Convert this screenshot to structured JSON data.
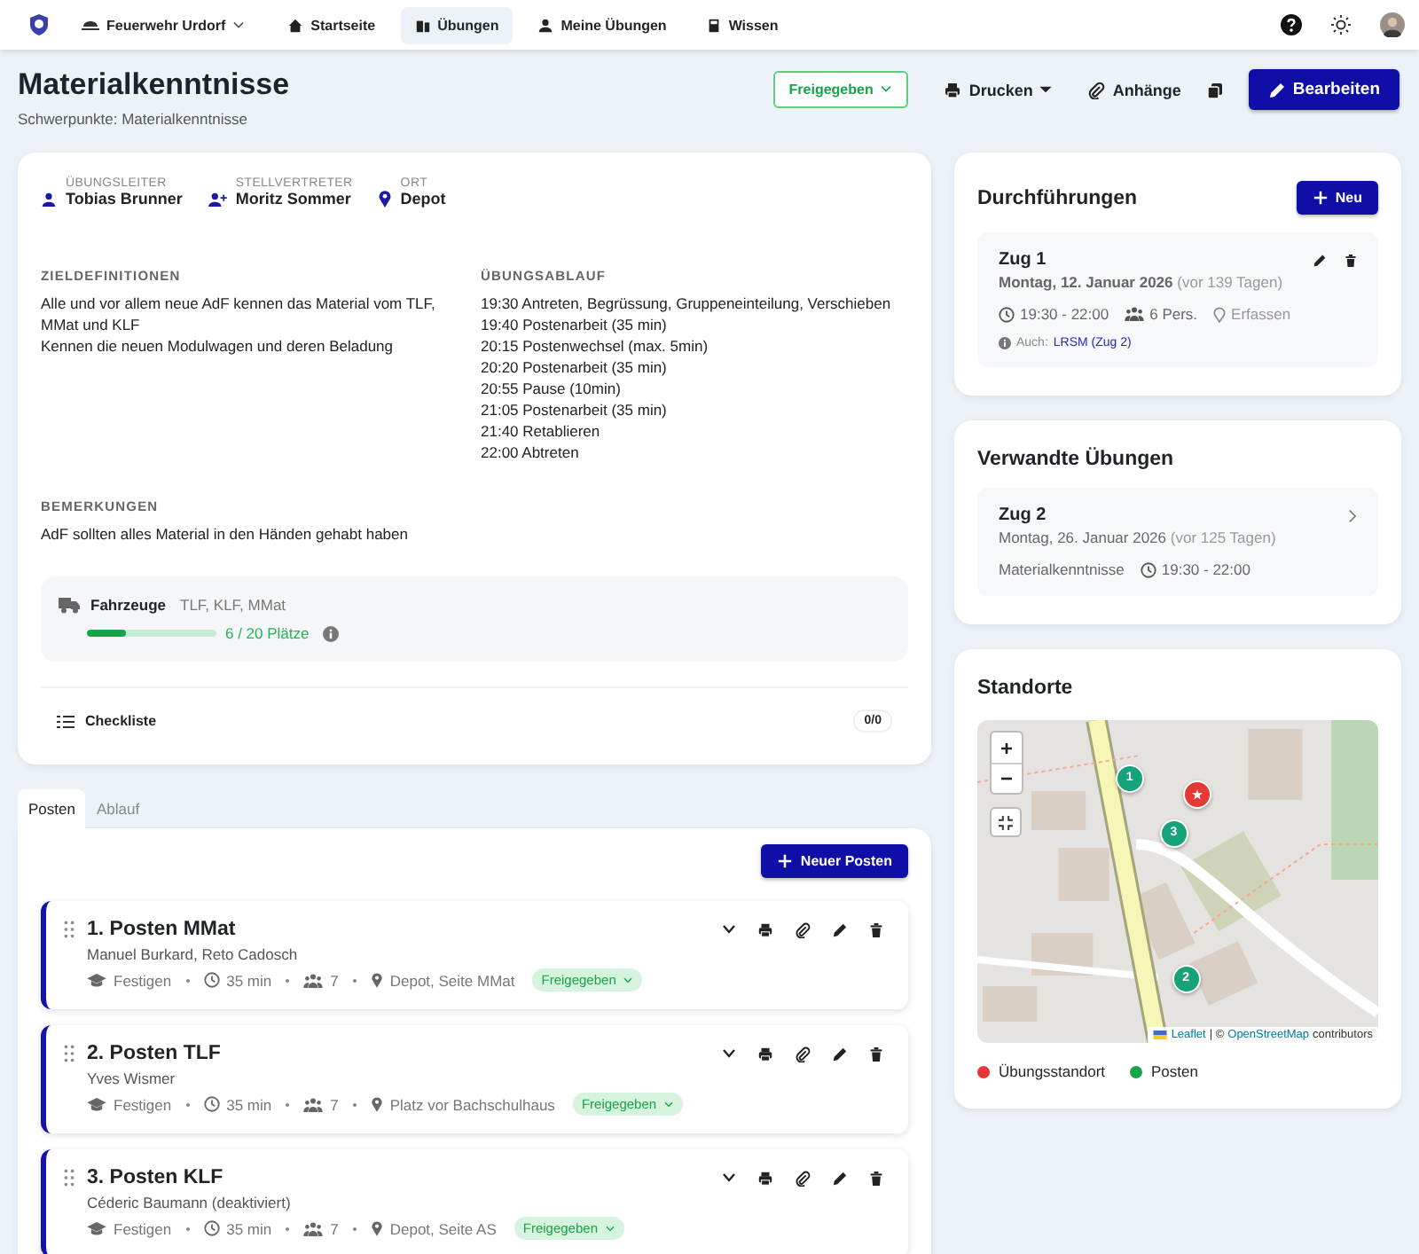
{
  "nav": {
    "org": "Feuerwehr Urdorf",
    "items": [
      {
        "label": "Startseite",
        "selected": false
      },
      {
        "label": "Übungen",
        "selected": true
      },
      {
        "label": "Meine Übungen",
        "selected": false
      },
      {
        "label": "Wissen",
        "selected": false
      }
    ]
  },
  "header": {
    "title": "Materialkenntnisse",
    "subtitle": "Schwerpunkte: Materialkenntnisse",
    "status": "Freigegeben",
    "print": "Drucken",
    "attachments": "Anhänge",
    "edit": "Bearbeiten"
  },
  "info": {
    "people": [
      {
        "label": "ÜBUNGSLEITER",
        "value": "Tobias Brunner",
        "kind": "person"
      },
      {
        "label": "STELLVERTRETER",
        "value": "Moritz Sommer",
        "kind": "deputy"
      },
      {
        "label": "ORT",
        "value": "Depot",
        "kind": "place"
      }
    ],
    "goals": {
      "heading": "ZIELDEFINITIONEN",
      "lines": [
        "Alle und vor allem neue AdF kennen das Material vom TLF, MMat und KLF",
        "Kennen die neuen Modulwagen und deren Beladung"
      ]
    },
    "schedule": {
      "heading": "ÜBUNGSABLAUF",
      "lines": [
        "19:30 Antreten, Begrüssung, Gruppeneinteilung, Verschieben",
        "19:40 Postenarbeit (35 min)",
        "20:15 Postenwechsel (max. 5min)",
        "20:20 Postenarbeit (35 min)",
        "20:55 Pause (10min)",
        "21:05 Postenarbeit (35 min)",
        "21:40 Retablieren",
        "22:00 Abtreten"
      ]
    },
    "remarks": {
      "heading": "BEMERKUNGEN",
      "text": "AdF sollten alles Material in den Händen gehabt haben"
    },
    "vehicles": {
      "label": "Fahrzeuge",
      "list": "TLF, KLF, MMat",
      "level": 0.3,
      "reading": "6 / 20 Plätze"
    },
    "checklist": {
      "label": "Checkliste",
      "count": "0/0"
    }
  },
  "tabs": [
    {
      "label": "Posten",
      "selected": true
    },
    {
      "label": "Ablauf",
      "selected": false
    }
  ],
  "new_post": "Neuer Posten",
  "posts": [
    {
      "title": "1. Posten MMat",
      "people": "Manuel Burkard, Reto Cadosch",
      "category": "Festigen",
      "duration": "35 min",
      "count": "7",
      "location": "Depot, Seite MMat",
      "status": "Freigegeben"
    },
    {
      "title": "2. Posten TLF",
      "people": "Yves Wismer",
      "category": "Festigen",
      "duration": "35 min",
      "count": "7",
      "location": "Platz vor Bachschulhaus",
      "status": "Freigegeben"
    },
    {
      "title": "3. Posten KLF",
      "people": "Céderic Baumann (deaktiviert)",
      "category": "Festigen",
      "duration": "35 min",
      "count": "7",
      "location": "Depot, Seite AS",
      "status": "Freigegeben"
    }
  ],
  "executions": {
    "title": "Durchführungen",
    "new": "Neu",
    "items": [
      {
        "name": "Zug 1",
        "date": "Montag, 12. Januar 2026",
        "relative": "(vor 139 Tagen)",
        "time": "19:30 - 22:00",
        "persons": "6 Pers.",
        "location": "Erfassen",
        "note": "Auch:",
        "link": "LRSM (Zug 2)"
      }
    ]
  },
  "related": {
    "title": "Verwandte Übungen",
    "items": [
      {
        "name": "Zug 2",
        "date": "Montag, 26. Januar 2026",
        "relative": "(vor 125 Tagen)",
        "topic": "Materialkenntnisse",
        "time": "19:30 - 22:00"
      }
    ]
  },
  "locations": {
    "title": "Standorte",
    "zoom_in": "+",
    "zoom_out": "−",
    "attribution_link": "Leaflet",
    "attribution_sep": "| ©",
    "attribution_osm": "OpenStreetMap",
    "attribution_tail": "contributors",
    "markers": [
      {
        "label": "1",
        "kind": "post"
      },
      {
        "kind": "venue"
      },
      {
        "label": "3",
        "kind": "post"
      },
      {
        "label": "2",
        "kind": "post"
      }
    ],
    "legend": [
      {
        "label": "Übungsstandort",
        "color": "#e53935"
      },
      {
        "label": "Posten",
        "color": "#16a34a"
      }
    ]
  }
}
